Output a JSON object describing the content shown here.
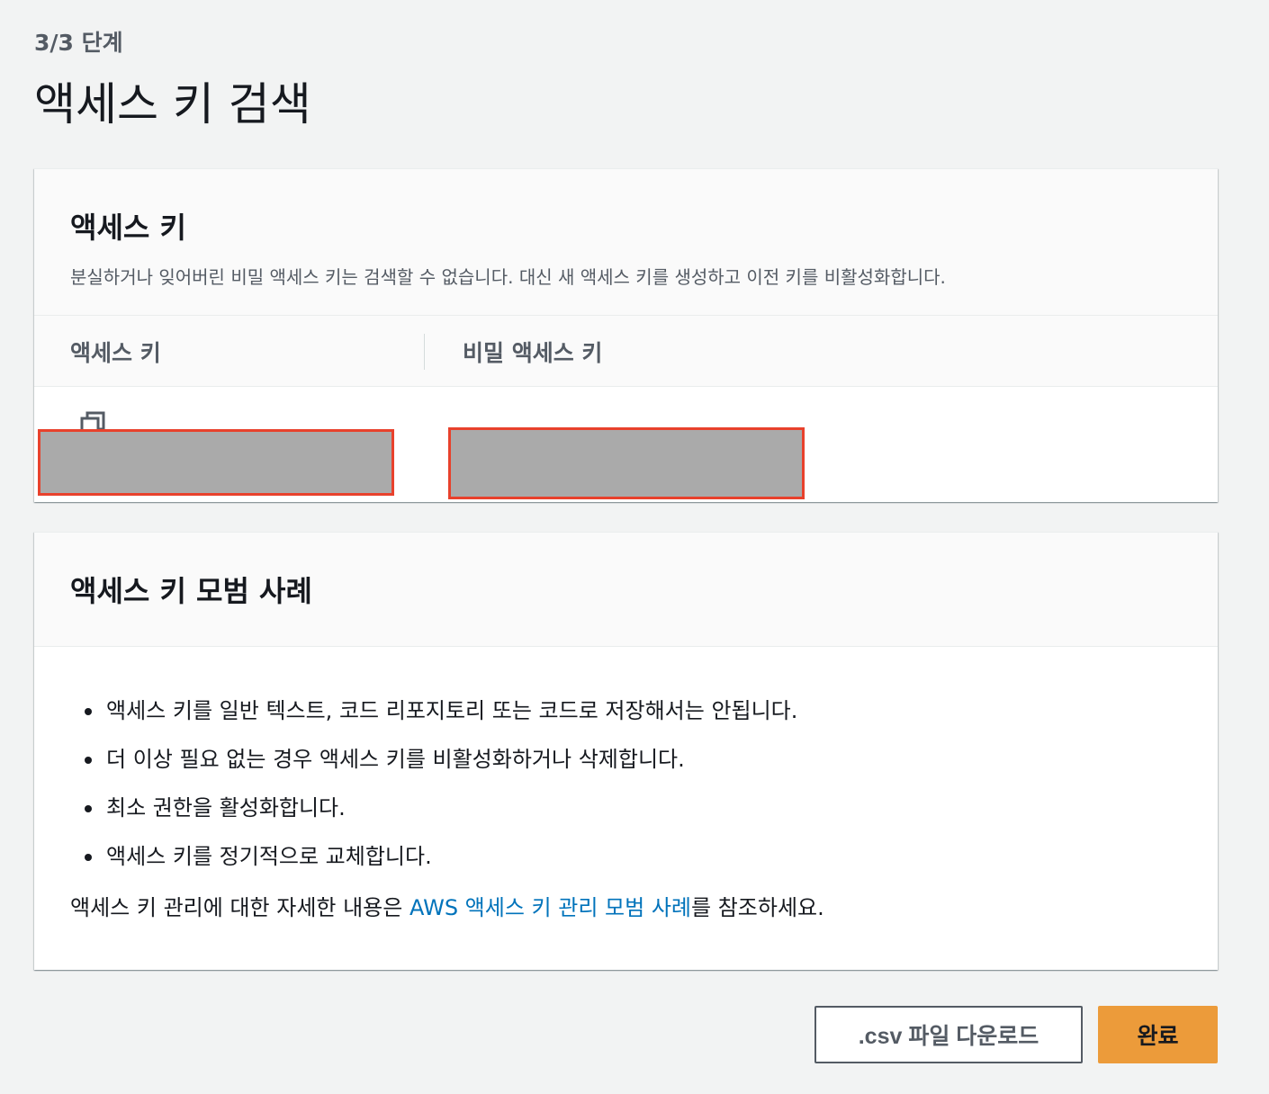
{
  "header": {
    "step": "3/3 단계",
    "title": "액세스 키 검색"
  },
  "keys_panel": {
    "title": "액세스 키",
    "description": "분실하거나 잊어버린 비밀 액세스 키는 검색할 수 없습니다. 대신 새 액세스 키를 생성하고 이전 키를 비활성화합니다.",
    "columns": [
      "액세스 키",
      "비밀 액세스 키"
    ],
    "copy_icon": "copy-icon"
  },
  "best_practices": {
    "title": "액세스 키 모범 사례",
    "items": [
      "액세스 키를 일반 텍스트, 코드 리포지토리 또는 코드로 저장해서는 안됩니다.",
      "더 이상 필요 없는 경우 액세스 키를 비활성화하거나 삭제합니다.",
      "최소 권한을 활성화합니다.",
      "액세스 키를 정기적으로 교체합니다."
    ],
    "ref_prefix": "액세스 키 관리에 대한 자세한 내용은 ",
    "ref_link": "AWS 액세스 키 관리 모범 사례",
    "ref_suffix": "를 참조하세요."
  },
  "buttons": {
    "download_csv": ".csv 파일 다운로드",
    "done": "완료"
  },
  "colors": {
    "primary_button": "#ec9b3a",
    "link": "#0073bb",
    "redaction_border": "#e8412c"
  }
}
